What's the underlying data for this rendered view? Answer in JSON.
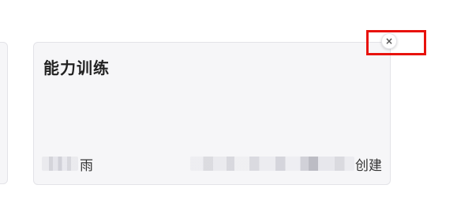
{
  "card": {
    "title": "能力训练",
    "author_suffix": "雨",
    "created_suffix": "创建"
  },
  "close_button": {
    "glyph": "×"
  },
  "colors": {
    "card_background": "#f6f6f8",
    "highlight": "#e8120c"
  }
}
